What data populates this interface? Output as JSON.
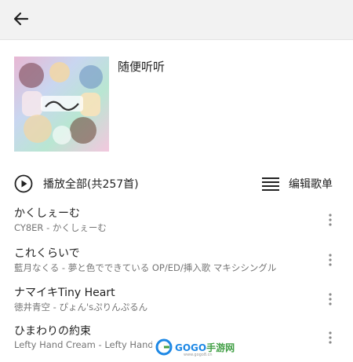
{
  "header": {
    "back_icon": "arrow-left-icon"
  },
  "playlist": {
    "title": "随便听听",
    "cover_icon": "album-cover"
  },
  "actions": {
    "play_all_label": "播放全部(共257首)",
    "play_icon": "play-circle-icon",
    "edit_label": "编辑歌单",
    "edit_icon": "list-icon"
  },
  "songs": [
    {
      "title": "かくしぇーむ",
      "subtitle": "CY8ER - かくしぇーむ"
    },
    {
      "title": "これくらいで",
      "subtitle": "藍月なくる - 夢と色でできている OP/ED/挿入歌 マキシシングル"
    },
    {
      "title": "ナマイキTiny Heart",
      "subtitle": "徳井青空 - ぴょん'sぷりんぷるん"
    },
    {
      "title": "ひまわりの約束",
      "subtitle": "Lefty Hand Cream - Lefty Hand Co"
    }
  ],
  "watermark": {
    "text_a": "GOGO",
    "text_b": "手游网",
    "url": "www.gogo8.cn"
  },
  "colors": {
    "topbar": "#f2f2f2",
    "text": "#222222",
    "subtext": "#757575",
    "icon": "#333333"
  }
}
